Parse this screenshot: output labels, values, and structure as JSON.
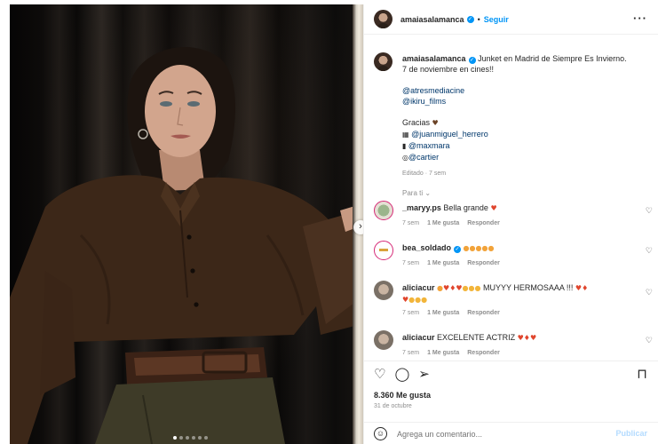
{
  "post": {
    "username": "amaiasalamanca",
    "follow_label": "Seguir",
    "more_icon": "more-horizontal-icon",
    "carousel": {
      "slides": 6,
      "active_slide": 1
    }
  },
  "caption": {
    "username": "amaiasalamanca",
    "text_line1": "Junket en Madrid de Siempre Es Invierno.",
    "text_line2": "7 de noviembre en cines!!",
    "mention1": "@atresmediacine",
    "mention2": "@ikiru_films",
    "thanks": "Gracias",
    "credit1": "@juanmiguel_herrero",
    "credit2": "@maxmara",
    "credit3": "@cartier",
    "edited": "Editado",
    "age": "7 sem",
    "see_translation": "Para ti"
  },
  "comments": [
    {
      "username": "_maryy.ps",
      "text": "Bella grande",
      "age": "7 sem",
      "likes": "1 Me gusta",
      "reply": "Responder"
    },
    {
      "username": "bea_soldado",
      "text": "",
      "age": "7 sem",
      "likes": "1 Me gusta",
      "reply": "Responder"
    },
    {
      "username": "aliciacur",
      "text": "MUYYY HERMOSAAA !!!",
      "age": "7 sem",
      "likes": "1 Me gusta",
      "reply": "Responder"
    },
    {
      "username": "aliciacur",
      "text": "EXCELENTE ACTRIZ",
      "age": "7 sem",
      "likes": "1 Me gusta",
      "reply": "Responder"
    }
  ],
  "footer": {
    "likes": "8.360 Me gusta",
    "date": "31 de octubre",
    "comment_placeholder": "Agrega un comentario...",
    "publish_label": "Publicar"
  },
  "colors": {
    "accent": "#0095f6",
    "text": "#262626",
    "muted": "#8e8e8e",
    "heart": "#ed4956"
  }
}
